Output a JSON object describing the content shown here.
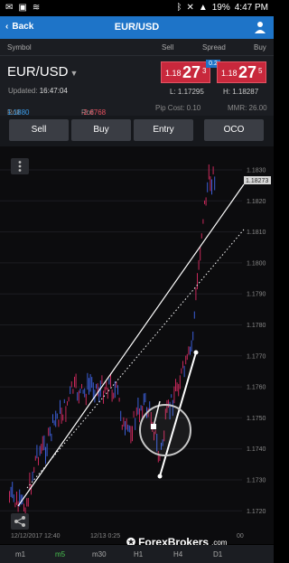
{
  "status": {
    "battery": "19%",
    "time": "4:47 PM"
  },
  "appbar": {
    "back": "Back",
    "title": "EUR/USD"
  },
  "columns": {
    "symbol": "Symbol",
    "sell": "Sell",
    "spread": "Spread",
    "buy": "Buy"
  },
  "quote": {
    "symbol": "EUR/USD",
    "updated_label": "Updated:",
    "updated": "16:47:04",
    "spread": "0.2",
    "sell": {
      "small": "1.18",
      "big": "27",
      "sup": "3"
    },
    "buy": {
      "small": "1.18",
      "big": "27",
      "sup": "5"
    },
    "low": "L: 1.17295",
    "high": "H: 1.18287"
  },
  "subinfo": {
    "roll_s_label": "Roll S:",
    "roll_s": "1.1880",
    "roll_b_label": "Roll B:",
    "roll_b": "-2.6768",
    "pip_cost": "Pip Cost: 0.10",
    "mmr": "MMR: 26.00"
  },
  "buttons": [
    "Sell",
    "Buy",
    "Entry",
    "OCO"
  ],
  "chart": {
    "y_ticks": [
      "1.1830",
      "1.1820",
      "1.1810",
      "1.1800",
      "1.1790",
      "1.1780",
      "1.1770",
      "1.1760",
      "1.1750",
      "1.1740",
      "1.1730",
      "1.1720"
    ],
    "current_price": "1.18273",
    "x_ticks": [
      "12/12/2017 12:40",
      "12/13 0:25",
      "00"
    ]
  },
  "timeframes": [
    "m1",
    "m5",
    "m30",
    "H1",
    "H4",
    "D1"
  ],
  "active_timeframe": "m5",
  "watermark": "ForexBrokers",
  "watermark_suffix": ".com",
  "colors": {
    "accent": "#1e74c8",
    "sell": "#c8283c",
    "active_tf": "#48c24f"
  }
}
